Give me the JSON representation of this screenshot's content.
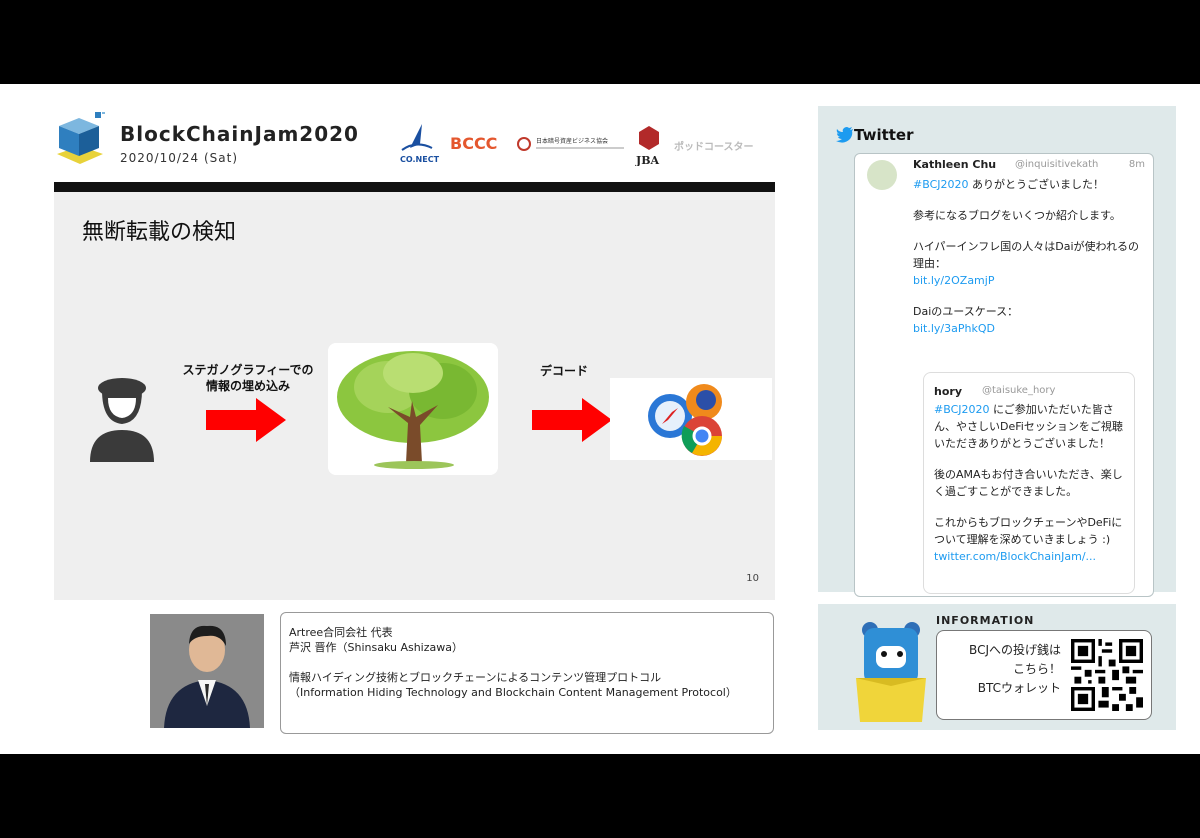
{
  "header": {
    "event_title": "BlockChainJam2020",
    "event_date": "2020/10/24 (Sat)",
    "sponsor_logos": [
      "CO.NECT",
      "BCCC",
      "日本暗号資産ビジネス協会",
      "JBA",
      "ポッドコースター"
    ]
  },
  "slide": {
    "title": "無断転載の検知",
    "step1_label": [
      "ステガノグラフィーでの",
      "情報の埋め込み"
    ],
    "step2_label": "デコード",
    "page_number": "10"
  },
  "speaker": {
    "company": "Artree合同会社 代表",
    "name": "芦沢 晋作（Shinsaku Ashizawa）",
    "talk_title_ja": "情報ハイディング技術とブロックチェーンによるコンテンツ管理プロトコル",
    "talk_title_en": "（Information Hiding Technology and Blockchain Content Management Protocol）"
  },
  "twitter": {
    "heading": "Twitter",
    "tweet": {
      "author": "Kathleen Chu",
      "handle": "@inquisitivekath",
      "time": "8m",
      "hashtag": "#BCJ2020",
      "line1": " ありがとうございました！",
      "para2": "参考になるブログをいくつか紹介します。",
      "para3": "ハイパーインフレ国の人々はDaiが使われるの理由：",
      "link1": "bit.ly/2OZamjP",
      "para4": "Daiのユースケース：",
      "link2": "bit.ly/3aPhkQD"
    },
    "quote": {
      "author": "hory",
      "handle": "@taisuke_hory",
      "hashtag": "#BCJ2020",
      "line1": " にご参加いただいた皆さん、やさしいDeFiセッションをご視聴いただきありがとうございました！",
      "para2": "後のAMAもお付き合いいただき、楽しく過ごすことができました。",
      "para3": "これからもブロックチェーンやDeFiについて理解を深めていきましょう :)",
      "link": "twitter.com/BlockChainJam/..."
    }
  },
  "info": {
    "heading": "INFORMATION",
    "line1": "BCJへの投げ銭は",
    "line2": "こちら！",
    "line3": "BTCウォレット"
  }
}
